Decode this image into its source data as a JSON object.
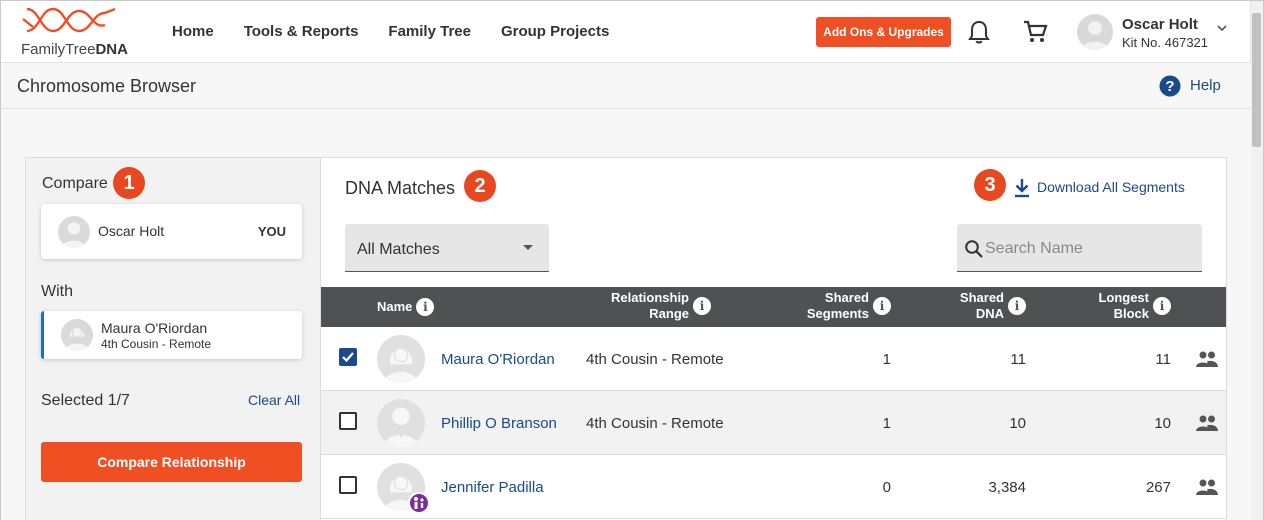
{
  "header": {
    "logo_text_regular": "FamilyTree",
    "logo_text_bold": "DNA",
    "nav": [
      "Home",
      "Tools & Reports",
      "Family Tree",
      "Group Projects"
    ],
    "addons_button": "Add Ons & Upgrades",
    "user": {
      "name": "Oscar Holt",
      "kit": "Kit No. 467321"
    },
    "accent_color": "#f04e23"
  },
  "subheader": {
    "title": "Chromosome Browser",
    "help_label": "Help"
  },
  "compare_panel": {
    "compare_label": "Compare",
    "step_compare": "1",
    "you": {
      "name": "Oscar Holt",
      "tag": "YOU"
    },
    "with_label": "With",
    "with": {
      "name": "Maura O'Riordan",
      "relationship": "4th Cousin - Remote"
    },
    "selected_label": "Selected 1/7",
    "clear_all": "Clear All",
    "compare_button": "Compare Relationship"
  },
  "matches_panel": {
    "title": "DNA Matches",
    "step_matches": "2",
    "step_download": "3",
    "download_label": "Download All Segments",
    "filter_value": "All Matches",
    "search_placeholder": "Search Name",
    "columns": {
      "name": "Name",
      "rel_1": "Relationship",
      "rel_2": "Range",
      "seg_1": "Shared",
      "seg_2": "Segments",
      "dna_1": "Shared",
      "dna_2": "DNA",
      "block_1": "Longest",
      "block_2": "Block"
    },
    "rows": [
      {
        "name": "Maura O'Riordan",
        "relationship": "4th Cousin - Remote",
        "shared_segments": "1",
        "shared_dna": "11",
        "longest_block": "11",
        "checked": true
      },
      {
        "name": "Phillip O Branson",
        "relationship": "4th Cousin - Remote",
        "shared_segments": "1",
        "shared_dna": "10",
        "longest_block": "10",
        "checked": false
      },
      {
        "name": "Jennifer Padilla",
        "relationship": "",
        "shared_segments": "0",
        "shared_dna": "3,384",
        "longest_block": "267",
        "checked": false
      }
    ]
  }
}
